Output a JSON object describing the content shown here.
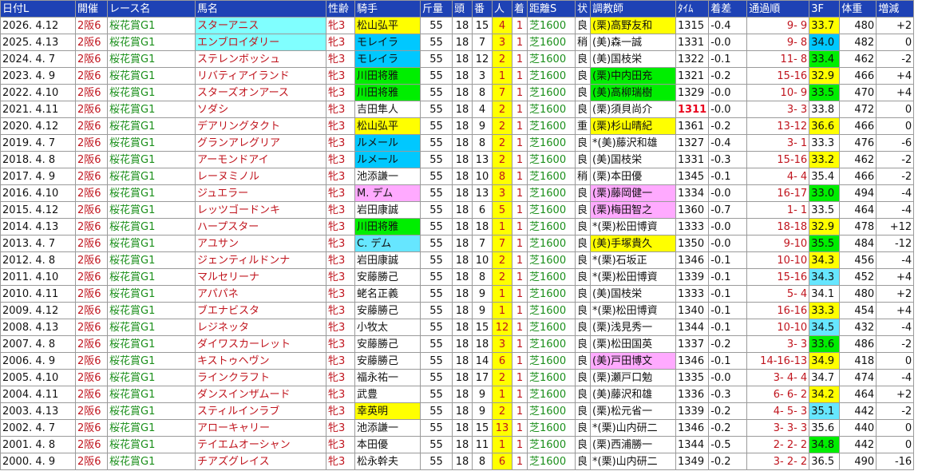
{
  "headers": [
    "日付L",
    "開催",
    "レース名",
    "馬名",
    "性齢",
    "騎手",
    "斤量",
    "頭",
    "番",
    "人",
    "着",
    "距離S",
    "状",
    "調教師",
    "ﾀｲﾑ",
    "着差",
    "通過順",
    "3F",
    "体重",
    "増減"
  ],
  "rows": [
    {
      "date": "2026. 4.12",
      "venue": "2阪6",
      "race": "桜花賞G1",
      "horse": "スターアニス",
      "sex": "牝3",
      "jockey": "松山弘平",
      "weight": "55",
      "heads": "18",
      "num": "15",
      "pop": "4",
      "rank": "1",
      "dist": "芝1600",
      "cond": "良",
      "trainer": "(栗)高野友和",
      "time": "1315",
      "margin": "-0.4",
      "pass": "9- 9",
      "f3": "33.7",
      "bw": "480",
      "diff": "+2",
      "hc": "cyan",
      "jc": "yellow",
      "tc": "yellow",
      "f3c": "yellow",
      "rec": false
    },
    {
      "date": "2025. 4.13",
      "venue": "2阪6",
      "race": "桜花賞G1",
      "horse": "エンブロイダリー",
      "sex": "牝3",
      "jockey": "モレイラ",
      "weight": "55",
      "heads": "18",
      "num": "7",
      "pop": "3",
      "rank": "1",
      "dist": "芝1600",
      "cond": "稍",
      "trainer": "(美)森一誠",
      "time": "1331",
      "margin": "-0.0",
      "pass": "9- 8",
      "f3": "34.0",
      "bw": "482",
      "diff": "0",
      "hc": "cyan",
      "jc": "blue",
      "tc": "",
      "f3c": "blue",
      "rec": false
    },
    {
      "date": "2024. 4. 7",
      "venue": "2阪6",
      "race": "桜花賞G1",
      "horse": "ステレンボッシュ",
      "sex": "牝3",
      "jockey": "モレイラ",
      "weight": "55",
      "heads": "18",
      "num": "12",
      "pop": "2",
      "rank": "1",
      "dist": "芝1600",
      "cond": "良",
      "trainer": "(美)国枝栄",
      "time": "1322",
      "margin": "-0.1",
      "pass": "11- 8",
      "f3": "33.4",
      "bw": "462",
      "diff": "-2",
      "hc": "",
      "jc": "blue",
      "tc": "",
      "f3c": "green",
      "rec": false
    },
    {
      "date": "2023. 4. 9",
      "venue": "2阪6",
      "race": "桜花賞G1",
      "horse": "リバティアイランド",
      "sex": "牝3",
      "jockey": "川田将雅",
      "weight": "55",
      "heads": "18",
      "num": "3",
      "pop": "1",
      "rank": "1",
      "dist": "芝1600",
      "cond": "良",
      "trainer": "(栗)中内田充",
      "time": "1321",
      "margin": "-0.2",
      "pass": "15-16",
      "f3": "32.9",
      "bw": "466",
      "diff": "+4",
      "hc": "",
      "jc": "green",
      "tc": "green",
      "f3c": "yellow",
      "rec": false
    },
    {
      "date": "2022. 4.10",
      "venue": "2阪6",
      "race": "桜花賞G1",
      "horse": "スターズオンアース",
      "sex": "牝3",
      "jockey": "川田将雅",
      "weight": "55",
      "heads": "18",
      "num": "8",
      "pop": "7",
      "rank": "1",
      "dist": "芝1600",
      "cond": "良",
      "trainer": "(美)高柳瑞樹",
      "time": "1329",
      "margin": "-0.0",
      "pass": "10- 9",
      "f3": "33.5",
      "bw": "470",
      "diff": "+4",
      "hc": "",
      "jc": "green",
      "tc": "green",
      "f3c": "green",
      "rec": false
    },
    {
      "date": "2021. 4.11",
      "venue": "2阪6",
      "race": "桜花賞G1",
      "horse": "ソダシ",
      "sex": "牝3",
      "jockey": "吉田隼人",
      "weight": "55",
      "heads": "18",
      "num": "4",
      "pop": "2",
      "rank": "1",
      "dist": "芝1600",
      "cond": "良",
      "trainer": "(栗)須貝尚介",
      "time": "1311",
      "margin": "-0.0",
      "pass": "3- 3",
      "f3": "33.8",
      "bw": "472",
      "diff": "0",
      "hc": "",
      "jc": "",
      "tc": "",
      "f3c": "",
      "rec": true
    },
    {
      "date": "2020. 4.12",
      "venue": "2阪6",
      "race": "桜花賞G1",
      "horse": "デアリングタクト",
      "sex": "牝3",
      "jockey": "松山弘平",
      "weight": "55",
      "heads": "18",
      "num": "9",
      "pop": "2",
      "rank": "1",
      "dist": "芝1600",
      "cond": "重",
      "trainer": "(栗)杉山晴紀",
      "time": "1361",
      "margin": "-0.2",
      "pass": "13-12",
      "f3": "36.6",
      "bw": "466",
      "diff": "0",
      "hc": "",
      "jc": "yellow",
      "tc": "yellow",
      "f3c": "yellow",
      "rec": false
    },
    {
      "date": "2019. 4. 7",
      "venue": "2阪6",
      "race": "桜花賞G1",
      "horse": "グランアレグリア",
      "sex": "牝3",
      "jockey": "ルメール",
      "weight": "55",
      "heads": "18",
      "num": "8",
      "pop": "2",
      "rank": "1",
      "dist": "芝1600",
      "cond": "良",
      "trainer": "*(美)藤沢和雄",
      "time": "1327",
      "margin": "-0.4",
      "pass": "3- 1",
      "f3": "33.3",
      "bw": "476",
      "diff": "-6",
      "hc": "",
      "jc": "blue",
      "tc": "",
      "f3c": "",
      "rec": false
    },
    {
      "date": "2018. 4. 8",
      "venue": "2阪6",
      "race": "桜花賞G1",
      "horse": "アーモンドアイ",
      "sex": "牝3",
      "jockey": "ルメール",
      "weight": "55",
      "heads": "18",
      "num": "13",
      "pop": "2",
      "rank": "1",
      "dist": "芝1600",
      "cond": "良",
      "trainer": "(美)国枝栄",
      "time": "1331",
      "margin": "-0.3",
      "pass": "15-16",
      "f3": "33.2",
      "bw": "462",
      "diff": "-2",
      "hc": "",
      "jc": "blue",
      "tc": "",
      "f3c": "yellow",
      "rec": false
    },
    {
      "date": "2017. 4. 9",
      "venue": "2阪6",
      "race": "桜花賞G1",
      "horse": "レーヌミノル",
      "sex": "牝3",
      "jockey": "池添謙一",
      "weight": "55",
      "heads": "18",
      "num": "10",
      "pop": "8",
      "rank": "1",
      "dist": "芝1600",
      "cond": "稍",
      "trainer": "(栗)本田優",
      "time": "1345",
      "margin": "-0.1",
      "pass": "4- 4",
      "f3": "35.4",
      "bw": "466",
      "diff": "-2",
      "hc": "",
      "jc": "",
      "tc": "",
      "f3c": "",
      "rec": false
    },
    {
      "date": "2016. 4.10",
      "venue": "2阪6",
      "race": "桜花賞G1",
      "horse": "ジュエラー",
      "sex": "牝3",
      "jockey": "M. デム",
      "weight": "55",
      "heads": "18",
      "num": "13",
      "pop": "3",
      "rank": "1",
      "dist": "芝1600",
      "cond": "良",
      "trainer": "(栗)藤岡健一",
      "time": "1334",
      "margin": "-0.0",
      "pass": "16-17",
      "f3": "33.0",
      "bw": "494",
      "diff": "-4",
      "hc": "",
      "jc": "pink",
      "tc": "pink",
      "f3c": "green",
      "rec": false
    },
    {
      "date": "2015. 4.12",
      "venue": "2阪6",
      "race": "桜花賞G1",
      "horse": "レッツゴードンキ",
      "sex": "牝3",
      "jockey": "岩田康誠",
      "weight": "55",
      "heads": "18",
      "num": "6",
      "pop": "5",
      "rank": "1",
      "dist": "芝1600",
      "cond": "良",
      "trainer": "(栗)梅田智之",
      "time": "1360",
      "margin": "-0.7",
      "pass": "1- 1",
      "f3": "33.5",
      "bw": "464",
      "diff": "-4",
      "hc": "",
      "jc": "",
      "tc": "pink",
      "f3c": "",
      "rec": false
    },
    {
      "date": "2014. 4.13",
      "venue": "2阪6",
      "race": "桜花賞G1",
      "horse": "ハープスター",
      "sex": "牝3",
      "jockey": "川田将雅",
      "weight": "55",
      "heads": "18",
      "num": "18",
      "pop": "1",
      "rank": "1",
      "dist": "芝1600",
      "cond": "良",
      "trainer": "*(栗)松田博資",
      "time": "1333",
      "margin": "-0.0",
      "pass": "18-18",
      "f3": "32.9",
      "bw": "478",
      "diff": "+12",
      "hc": "",
      "jc": "green",
      "tc": "",
      "f3c": "yellow",
      "rec": false
    },
    {
      "date": "2013. 4. 7",
      "venue": "2阪6",
      "race": "桜花賞G1",
      "horse": "アユサン",
      "sex": "牝3",
      "jockey": "C. デム",
      "weight": "55",
      "heads": "18",
      "num": "7",
      "pop": "7",
      "rank": "1",
      "dist": "芝1600",
      "cond": "良",
      "trainer": "(美)手塚貴久",
      "time": "1350",
      "margin": "-0.0",
      "pass": "9-10",
      "f3": "35.5",
      "bw": "484",
      "diff": "-12",
      "hc": "",
      "jc": "lightblue",
      "tc": "yellow",
      "f3c": "green",
      "rec": false
    },
    {
      "date": "2012. 4. 8",
      "venue": "2阪6",
      "race": "桜花賞G1",
      "horse": "ジェンティルドンナ",
      "sex": "牝3",
      "jockey": "岩田康誠",
      "weight": "55",
      "heads": "18",
      "num": "10",
      "pop": "2",
      "rank": "1",
      "dist": "芝1600",
      "cond": "良",
      "trainer": "*(栗)石坂正",
      "time": "1346",
      "margin": "-0.1",
      "pass": "10-10",
      "f3": "34.3",
      "bw": "456",
      "diff": "-4",
      "hc": "",
      "jc": "",
      "tc": "",
      "f3c": "yellow",
      "rec": false
    },
    {
      "date": "2011. 4.10",
      "venue": "2阪6",
      "race": "桜花賞G1",
      "horse": "マルセリーナ",
      "sex": "牝3",
      "jockey": "安藤勝己",
      "weight": "55",
      "heads": "18",
      "num": "8",
      "pop": "2",
      "rank": "1",
      "dist": "芝1600",
      "cond": "良",
      "trainer": "*(栗)松田博資",
      "time": "1339",
      "margin": "-0.1",
      "pass": "15-16",
      "f3": "34.3",
      "bw": "452",
      "diff": "+4",
      "hc": "",
      "jc": "",
      "tc": "",
      "f3c": "lightblue",
      "rec": false
    },
    {
      "date": "2010. 4.11",
      "venue": "2阪6",
      "race": "桜花賞G1",
      "horse": "アパパネ",
      "sex": "牝3",
      "jockey": "蛯名正義",
      "weight": "55",
      "heads": "18",
      "num": "9",
      "pop": "1",
      "rank": "1",
      "dist": "芝1600",
      "cond": "良",
      "trainer": "(美)国枝栄",
      "time": "1333",
      "margin": "-0.1",
      "pass": "5- 4",
      "f3": "34.1",
      "bw": "480",
      "diff": "+2",
      "hc": "",
      "jc": "",
      "tc": "",
      "f3c": "",
      "rec": false
    },
    {
      "date": "2009. 4.12",
      "venue": "2阪6",
      "race": "桜花賞G1",
      "horse": "ブエナビスタ",
      "sex": "牝3",
      "jockey": "安藤勝己",
      "weight": "55",
      "heads": "18",
      "num": "9",
      "pop": "1",
      "rank": "1",
      "dist": "芝1600",
      "cond": "良",
      "trainer": "*(栗)松田博資",
      "time": "1340",
      "margin": "-0.1",
      "pass": "16-16",
      "f3": "33.3",
      "bw": "454",
      "diff": "+4",
      "hc": "",
      "jc": "",
      "tc": "",
      "f3c": "yellow",
      "rec": false
    },
    {
      "date": "2008. 4.13",
      "venue": "2阪6",
      "race": "桜花賞G1",
      "horse": "レジネッタ",
      "sex": "牝3",
      "jockey": "小牧太",
      "weight": "55",
      "heads": "18",
      "num": "15",
      "pop": "12",
      "rank": "1",
      "dist": "芝1600",
      "cond": "良",
      "trainer": "(栗)浅見秀一",
      "time": "1344",
      "margin": "-0.1",
      "pass": "10-10",
      "f3": "34.5",
      "bw": "432",
      "diff": "-4",
      "hc": "",
      "jc": "",
      "tc": "",
      "f3c": "lightblue",
      "rec": false
    },
    {
      "date": "2007. 4. 8",
      "venue": "2阪6",
      "race": "桜花賞G1",
      "horse": "ダイワスカーレット",
      "sex": "牝3",
      "jockey": "安藤勝己",
      "weight": "55",
      "heads": "18",
      "num": "18",
      "pop": "3",
      "rank": "1",
      "dist": "芝1600",
      "cond": "良",
      "trainer": "(栗)松田国英",
      "time": "1337",
      "margin": "-0.2",
      "pass": "3- 3",
      "f3": "33.6",
      "bw": "486",
      "diff": "-2",
      "hc": "",
      "jc": "",
      "tc": "",
      "f3c": "green",
      "rec": false
    },
    {
      "date": "2006. 4. 9",
      "venue": "2阪6",
      "race": "桜花賞G1",
      "horse": "キストゥヘヴン",
      "sex": "牝3",
      "jockey": "安藤勝己",
      "weight": "55",
      "heads": "18",
      "num": "14",
      "pop": "6",
      "rank": "1",
      "dist": "芝1600",
      "cond": "良",
      "trainer": "(美)戸田博文",
      "time": "1346",
      "margin": "-0.1",
      "pass": "14-16-13",
      "f3": "34.9",
      "bw": "418",
      "diff": "0",
      "hc": "",
      "jc": "",
      "tc": "pink",
      "f3c": "yellow",
      "rec": false
    },
    {
      "date": "2005. 4.10",
      "venue": "2阪6",
      "race": "桜花賞G1",
      "horse": "ラインクラフト",
      "sex": "牝3",
      "jockey": "福永祐一",
      "weight": "55",
      "heads": "18",
      "num": "17",
      "pop": "2",
      "rank": "1",
      "dist": "芝1600",
      "cond": "良",
      "trainer": "(栗)瀬戸口勉",
      "time": "1335",
      "margin": "-0.0",
      "pass": "3- 4- 4",
      "f3": "34.7",
      "bw": "474",
      "diff": "-4",
      "hc": "",
      "jc": "",
      "tc": "",
      "f3c": "",
      "rec": false
    },
    {
      "date": "2004. 4.11",
      "venue": "2阪6",
      "race": "桜花賞G1",
      "horse": "ダンスインザムード",
      "sex": "牝3",
      "jockey": "武豊",
      "weight": "55",
      "heads": "18",
      "num": "9",
      "pop": "1",
      "rank": "1",
      "dist": "芝1600",
      "cond": "良",
      "trainer": "(美)藤沢和雄",
      "time": "1336",
      "margin": "-0.3",
      "pass": "6- 6- 2",
      "f3": "34.2",
      "bw": "464",
      "diff": "+2",
      "hc": "",
      "jc": "",
      "tc": "",
      "f3c": "yellow",
      "rec": false
    },
    {
      "date": "2003. 4.13",
      "venue": "2阪6",
      "race": "桜花賞G1",
      "horse": "スティルインラブ",
      "sex": "牝3",
      "jockey": "幸英明",
      "weight": "55",
      "heads": "18",
      "num": "9",
      "pop": "2",
      "rank": "1",
      "dist": "芝1600",
      "cond": "良",
      "trainer": "(栗)松元省一",
      "time": "1339",
      "margin": "-0.2",
      "pass": "4- 5- 3",
      "f3": "35.1",
      "bw": "442",
      "diff": "-2",
      "hc": "",
      "jc": "yellow",
      "tc": "",
      "f3c": "lightblue",
      "rec": false
    },
    {
      "date": "2002. 4. 7",
      "venue": "2阪6",
      "race": "桜花賞G1",
      "horse": "アローキャリー",
      "sex": "牝3",
      "jockey": "池添謙一",
      "weight": "55",
      "heads": "18",
      "num": "15",
      "pop": "13",
      "rank": "1",
      "dist": "芝1600",
      "cond": "良",
      "trainer": "*(栗)山内研二",
      "time": "1346",
      "margin": "-0.2",
      "pass": "3- 3- 3",
      "f3": "35.6",
      "bw": "440",
      "diff": "0",
      "hc": "",
      "jc": "",
      "tc": "",
      "f3c": "",
      "rec": false
    },
    {
      "date": "2001. 4. 8",
      "venue": "2阪6",
      "race": "桜花賞G1",
      "horse": "テイエムオーシャン",
      "sex": "牝3",
      "jockey": "本田優",
      "weight": "55",
      "heads": "18",
      "num": "11",
      "pop": "1",
      "rank": "1",
      "dist": "芝1600",
      "cond": "良",
      "trainer": "(栗)西浦勝一",
      "time": "1344",
      "margin": "-0.5",
      "pass": "2- 2- 2",
      "f3": "34.8",
      "bw": "442",
      "diff": "0",
      "hc": "",
      "jc": "",
      "tc": "",
      "f3c": "green",
      "rec": false
    },
    {
      "date": "2000. 4. 9",
      "venue": "2阪6",
      "race": "桜花賞G1",
      "horse": "チアズグレイス",
      "sex": "牝3",
      "jockey": "松永幹夫",
      "weight": "55",
      "heads": "18",
      "num": "8",
      "pop": "6",
      "rank": "1",
      "dist": "芝1600",
      "cond": "良",
      "trainer": "*(栗)山内研二",
      "time": "1349",
      "margin": "-0.2",
      "pass": "3- 2- 2",
      "f3": "36.5",
      "bw": "490",
      "diff": "-16",
      "hc": "",
      "jc": "",
      "tc": "",
      "f3c": "",
      "rec": false
    }
  ]
}
